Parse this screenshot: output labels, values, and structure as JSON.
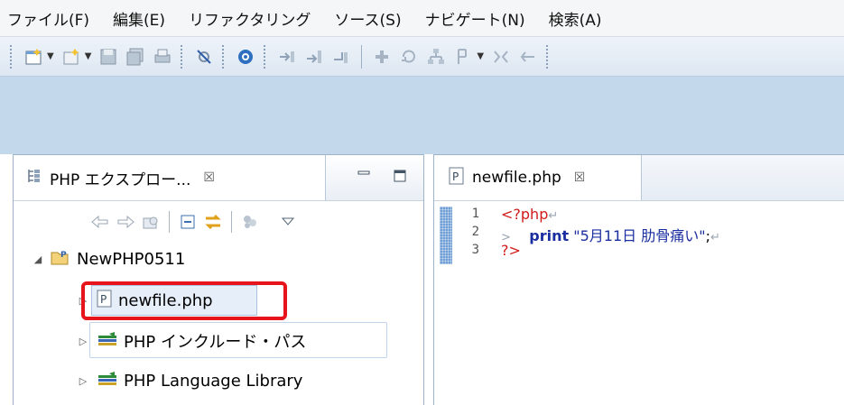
{
  "menubar": {
    "items": [
      "ファイル(F)",
      "編集(E)",
      "リファクタリング",
      "ソース(S)",
      "ナビゲート(N)",
      "検索(A)"
    ]
  },
  "explorer": {
    "tab_label": "PHP エクスプロー...",
    "close_glyph": "☒",
    "tree": {
      "project": "NewPHP0511",
      "file": "newfile.php",
      "include_path": "PHP インクルード・パス",
      "library": "PHP Language Library"
    }
  },
  "editor": {
    "tab_label": "newfile.php",
    "close_glyph": "☒",
    "lines": [
      {
        "no": "1",
        "open_tag": "<?php",
        "eol": "↵"
      },
      {
        "no": "2",
        "indent": ">",
        "keyword": "print",
        "string": "\"5月11日 肋骨痛い\"",
        "term": ";",
        "eol": "↵"
      },
      {
        "no": "3",
        "close_tag": "?>"
      }
    ]
  },
  "colors": {
    "highlight": "#e8141b",
    "toolbar_bg": "#c4d8ec",
    "php_tag": "#d11a1a",
    "keyword": "#1a2ea0"
  }
}
